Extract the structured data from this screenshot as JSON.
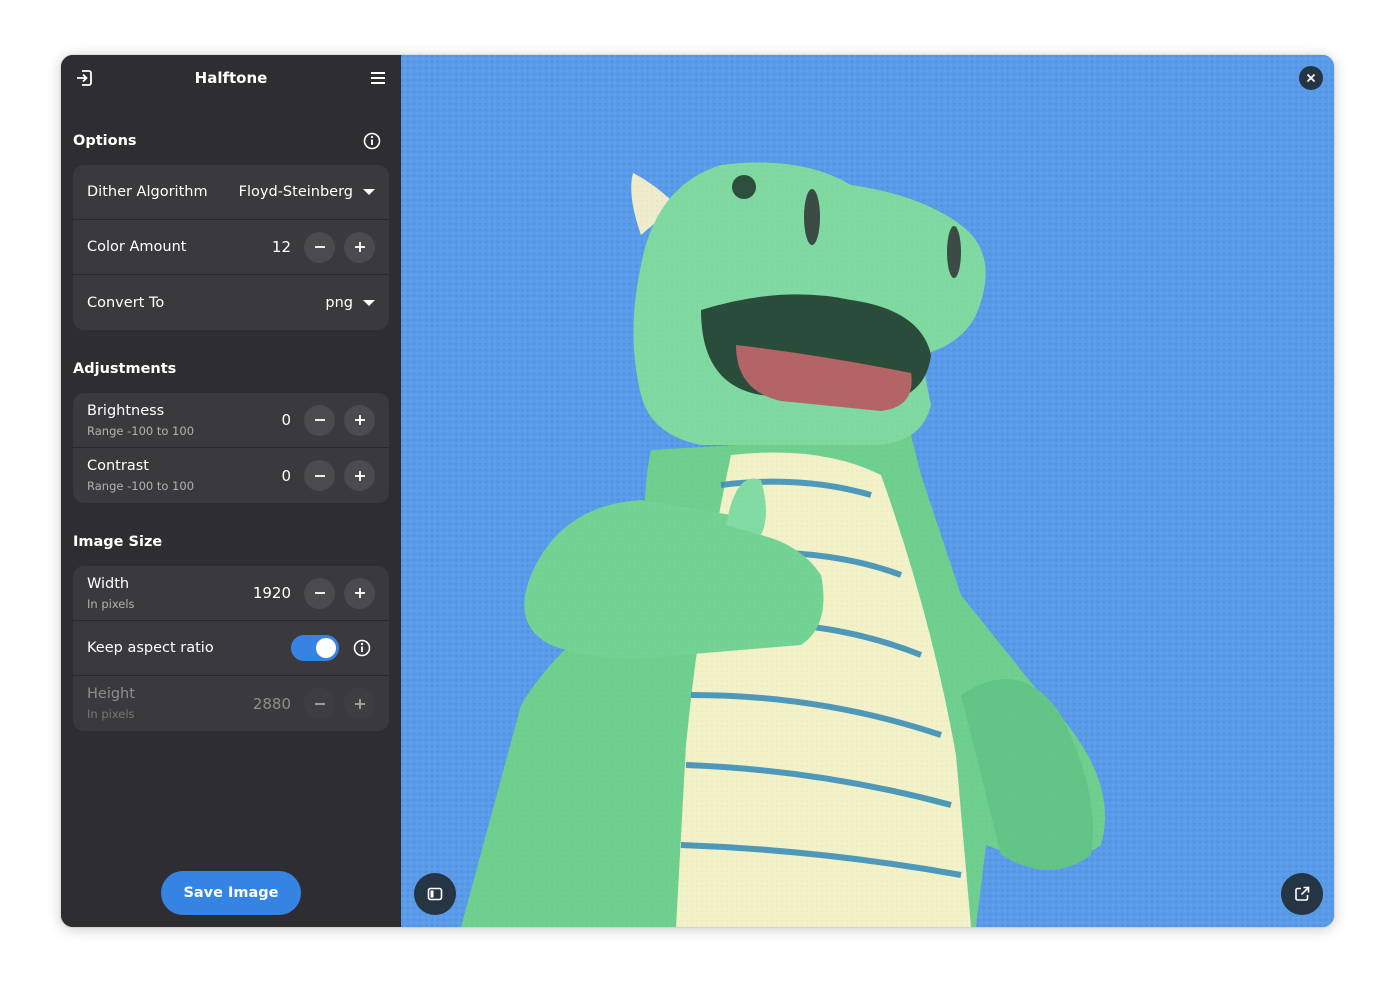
{
  "app": {
    "title": "Halftone"
  },
  "header": {
    "open_icon": "open-file-icon",
    "menu_icon": "hamburger-menu-icon"
  },
  "options": {
    "title": "Options",
    "info_icon": "info-icon",
    "dither": {
      "label": "Dither Algorithm",
      "value": "Floyd-Steinberg"
    },
    "color_amount": {
      "label": "Color Amount",
      "value": "12"
    },
    "convert_to": {
      "label": "Convert To",
      "value": "png"
    }
  },
  "adjustments": {
    "title": "Adjustments",
    "brightness": {
      "label": "Brightness",
      "sub": "Range -100 to 100",
      "value": "0"
    },
    "contrast": {
      "label": "Contrast",
      "sub": "Range -100 to 100",
      "value": "0"
    }
  },
  "image_size": {
    "title": "Image Size",
    "width": {
      "label": "Width",
      "sub": "In pixels",
      "value": "1920"
    },
    "keep_aspect": {
      "label": "Keep aspect ratio",
      "enabled": true
    },
    "height": {
      "label": "Height",
      "sub": "In pixels",
      "value": "2880"
    }
  },
  "actions": {
    "save_label": "Save Image"
  },
  "preview": {
    "close_icon": "close-icon",
    "sidebar_toggle_icon": "sidebar-toggle-icon",
    "open_external_icon": "open-external-icon"
  },
  "colors": {
    "accent": "#3584e4",
    "sidebar_bg": "#2e2e32",
    "card_bg": "#3a3a3e",
    "sky": "#5a9bea",
    "dragon_green": "#6fcf8f",
    "belly": "#f3f1c8"
  }
}
